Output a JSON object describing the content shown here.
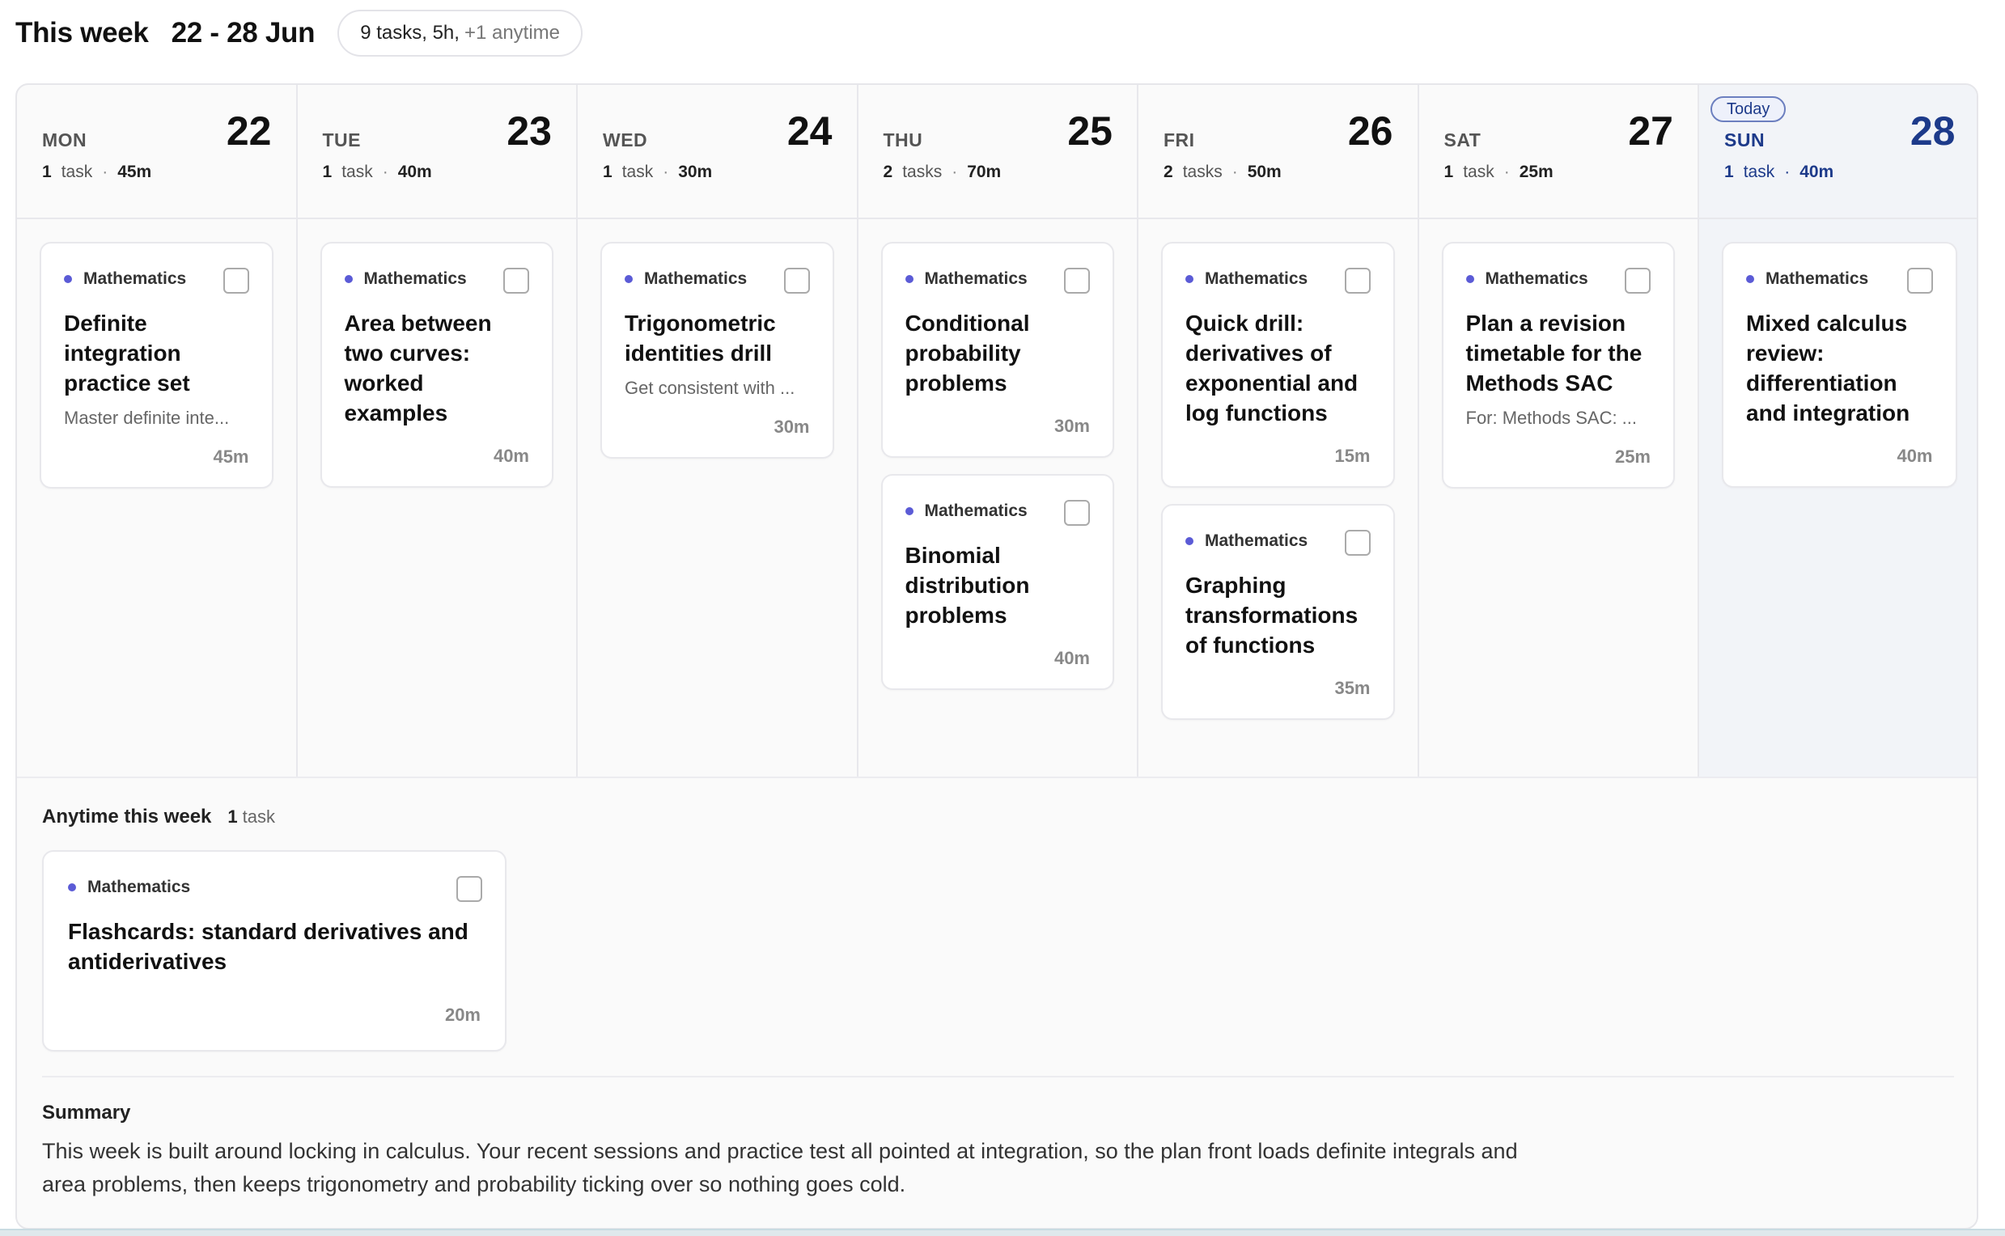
{
  "header": {
    "title": "This week",
    "range": "22 - 28 Jun",
    "stats": "9 tasks, 5h,",
    "stats_extra": "+1 anytime"
  },
  "today_badge": "Today",
  "days": [
    {
      "dow": "MON",
      "num": "22",
      "count": "1",
      "unit": "task",
      "dur": "45m",
      "cards": [
        {
          "subject": "Mathematics",
          "title": "Definite integration practice set",
          "desc": "Master definite inte...",
          "dur": "45m"
        }
      ]
    },
    {
      "dow": "TUE",
      "num": "23",
      "count": "1",
      "unit": "task",
      "dur": "40m",
      "cards": [
        {
          "subject": "Mathematics",
          "title": "Area between two curves: worked examples",
          "desc": "",
          "dur": "40m"
        }
      ]
    },
    {
      "dow": "WED",
      "num": "24",
      "count": "1",
      "unit": "task",
      "dur": "30m",
      "cards": [
        {
          "subject": "Mathematics",
          "title": "Trigonometric identities drill",
          "desc": "Get consistent with ...",
          "dur": "30m"
        }
      ]
    },
    {
      "dow": "THU",
      "num": "25",
      "count": "2",
      "unit": "tasks",
      "dur": "70m",
      "cards": [
        {
          "subject": "Mathematics",
          "title": "Conditional probability problems",
          "desc": "",
          "dur": "30m"
        },
        {
          "subject": "Mathematics",
          "title": "Binomial distribution problems",
          "desc": "",
          "dur": "40m"
        }
      ]
    },
    {
      "dow": "FRI",
      "num": "26",
      "count": "2",
      "unit": "tasks",
      "dur": "50m",
      "cards": [
        {
          "subject": "Mathematics",
          "title": "Quick drill: derivatives of exponential and log functions",
          "desc": "",
          "dur": "15m"
        },
        {
          "subject": "Mathematics",
          "title": "Graphing transformations of functions",
          "desc": "",
          "dur": "35m"
        }
      ]
    },
    {
      "dow": "SAT",
      "num": "27",
      "count": "1",
      "unit": "task",
      "dur": "25m",
      "cards": [
        {
          "subject": "Mathematics",
          "title": "Plan a revision timetable for the Methods SAC",
          "desc": "For: Methods SAC: ...",
          "dur": "25m"
        }
      ]
    },
    {
      "dow": "SUN",
      "num": "28",
      "count": "1",
      "unit": "task",
      "dur": "40m",
      "today": true,
      "cards": [
        {
          "subject": "Mathematics",
          "title": "Mixed calculus review: differentiation and integration",
          "desc": "",
          "dur": "40m"
        }
      ]
    }
  ],
  "anytime": {
    "label": "Anytime this week",
    "count": "1",
    "unit": "task",
    "card": {
      "subject": "Mathematics",
      "title": "Flashcards: standard derivatives and antiderivatives",
      "dur": "20m"
    }
  },
  "summary": {
    "title": "Summary",
    "text": "This week is built around locking in calculus. Your recent sessions and practice test all pointed at integration, so the plan front loads definite integrals and area problems, then keeps trigonometry and probability ticking over so nothing goes cold."
  },
  "colors": {
    "subject_dot": "#5b5bd6",
    "today_accent": "#1d3a8a"
  }
}
